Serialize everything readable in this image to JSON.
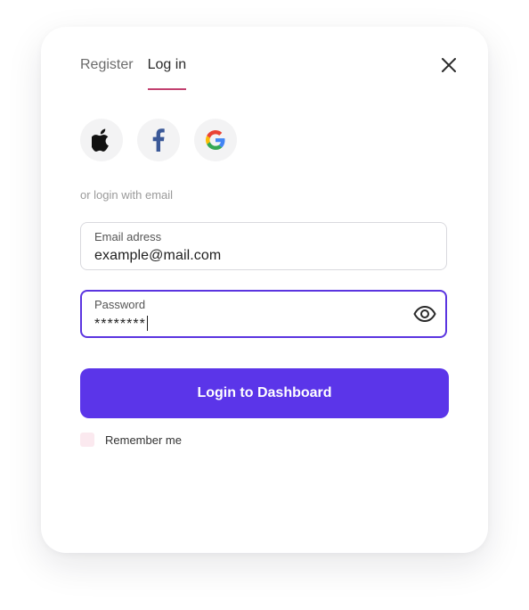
{
  "tabs": {
    "register": "Register",
    "login": "Log in"
  },
  "social": {
    "apple": "apple-icon",
    "facebook": "facebook-icon",
    "google": "google-icon"
  },
  "separator_text": "or login with email",
  "email": {
    "label": "Email adress",
    "value": "example@mail.com"
  },
  "password": {
    "label": "Password",
    "value": "********"
  },
  "login_button": "Login to Dashboard",
  "remember_label": "Remember me",
  "colors": {
    "accent": "#5b35e9",
    "tab_underline": "#c2406f",
    "checkbox_bg": "#fbe9ef"
  }
}
